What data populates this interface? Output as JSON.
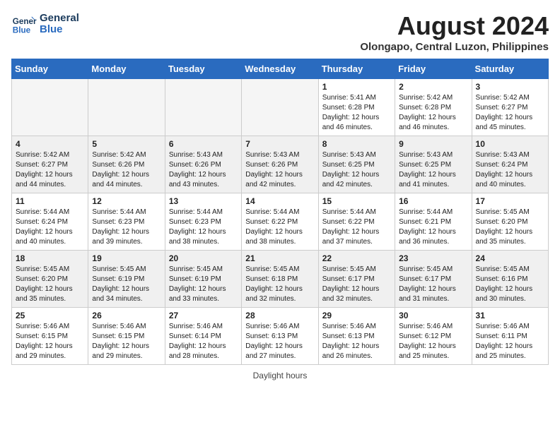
{
  "header": {
    "logo_line1": "General",
    "logo_line2": "Blue",
    "month": "August 2024",
    "location": "Olongapo, Central Luzon, Philippines"
  },
  "days_of_week": [
    "Sunday",
    "Monday",
    "Tuesday",
    "Wednesday",
    "Thursday",
    "Friday",
    "Saturday"
  ],
  "footer": {
    "daylight_hours_label": "Daylight hours"
  },
  "weeks": [
    [
      {
        "day": "",
        "info": ""
      },
      {
        "day": "",
        "info": ""
      },
      {
        "day": "",
        "info": ""
      },
      {
        "day": "",
        "info": ""
      },
      {
        "day": "1",
        "info": "Sunrise: 5:41 AM\nSunset: 6:28 PM\nDaylight: 12 hours\nand 46 minutes."
      },
      {
        "day": "2",
        "info": "Sunrise: 5:42 AM\nSunset: 6:28 PM\nDaylight: 12 hours\nand 46 minutes."
      },
      {
        "day": "3",
        "info": "Sunrise: 5:42 AM\nSunset: 6:27 PM\nDaylight: 12 hours\nand 45 minutes."
      }
    ],
    [
      {
        "day": "4",
        "info": "Sunrise: 5:42 AM\nSunset: 6:27 PM\nDaylight: 12 hours\nand 44 minutes."
      },
      {
        "day": "5",
        "info": "Sunrise: 5:42 AM\nSunset: 6:26 PM\nDaylight: 12 hours\nand 44 minutes."
      },
      {
        "day": "6",
        "info": "Sunrise: 5:43 AM\nSunset: 6:26 PM\nDaylight: 12 hours\nand 43 minutes."
      },
      {
        "day": "7",
        "info": "Sunrise: 5:43 AM\nSunset: 6:26 PM\nDaylight: 12 hours\nand 42 minutes."
      },
      {
        "day": "8",
        "info": "Sunrise: 5:43 AM\nSunset: 6:25 PM\nDaylight: 12 hours\nand 42 minutes."
      },
      {
        "day": "9",
        "info": "Sunrise: 5:43 AM\nSunset: 6:25 PM\nDaylight: 12 hours\nand 41 minutes."
      },
      {
        "day": "10",
        "info": "Sunrise: 5:43 AM\nSunset: 6:24 PM\nDaylight: 12 hours\nand 40 minutes."
      }
    ],
    [
      {
        "day": "11",
        "info": "Sunrise: 5:44 AM\nSunset: 6:24 PM\nDaylight: 12 hours\nand 40 minutes."
      },
      {
        "day": "12",
        "info": "Sunrise: 5:44 AM\nSunset: 6:23 PM\nDaylight: 12 hours\nand 39 minutes."
      },
      {
        "day": "13",
        "info": "Sunrise: 5:44 AM\nSunset: 6:23 PM\nDaylight: 12 hours\nand 38 minutes."
      },
      {
        "day": "14",
        "info": "Sunrise: 5:44 AM\nSunset: 6:22 PM\nDaylight: 12 hours\nand 38 minutes."
      },
      {
        "day": "15",
        "info": "Sunrise: 5:44 AM\nSunset: 6:22 PM\nDaylight: 12 hours\nand 37 minutes."
      },
      {
        "day": "16",
        "info": "Sunrise: 5:44 AM\nSunset: 6:21 PM\nDaylight: 12 hours\nand 36 minutes."
      },
      {
        "day": "17",
        "info": "Sunrise: 5:45 AM\nSunset: 6:20 PM\nDaylight: 12 hours\nand 35 minutes."
      }
    ],
    [
      {
        "day": "18",
        "info": "Sunrise: 5:45 AM\nSunset: 6:20 PM\nDaylight: 12 hours\nand 35 minutes."
      },
      {
        "day": "19",
        "info": "Sunrise: 5:45 AM\nSunset: 6:19 PM\nDaylight: 12 hours\nand 34 minutes."
      },
      {
        "day": "20",
        "info": "Sunrise: 5:45 AM\nSunset: 6:19 PM\nDaylight: 12 hours\nand 33 minutes."
      },
      {
        "day": "21",
        "info": "Sunrise: 5:45 AM\nSunset: 6:18 PM\nDaylight: 12 hours\nand 32 minutes."
      },
      {
        "day": "22",
        "info": "Sunrise: 5:45 AM\nSunset: 6:17 PM\nDaylight: 12 hours\nand 32 minutes."
      },
      {
        "day": "23",
        "info": "Sunrise: 5:45 AM\nSunset: 6:17 PM\nDaylight: 12 hours\nand 31 minutes."
      },
      {
        "day": "24",
        "info": "Sunrise: 5:45 AM\nSunset: 6:16 PM\nDaylight: 12 hours\nand 30 minutes."
      }
    ],
    [
      {
        "day": "25",
        "info": "Sunrise: 5:46 AM\nSunset: 6:15 PM\nDaylight: 12 hours\nand 29 minutes."
      },
      {
        "day": "26",
        "info": "Sunrise: 5:46 AM\nSunset: 6:15 PM\nDaylight: 12 hours\nand 29 minutes."
      },
      {
        "day": "27",
        "info": "Sunrise: 5:46 AM\nSunset: 6:14 PM\nDaylight: 12 hours\nand 28 minutes."
      },
      {
        "day": "28",
        "info": "Sunrise: 5:46 AM\nSunset: 6:13 PM\nDaylight: 12 hours\nand 27 minutes."
      },
      {
        "day": "29",
        "info": "Sunrise: 5:46 AM\nSunset: 6:13 PM\nDaylight: 12 hours\nand 26 minutes."
      },
      {
        "day": "30",
        "info": "Sunrise: 5:46 AM\nSunset: 6:12 PM\nDaylight: 12 hours\nand 25 minutes."
      },
      {
        "day": "31",
        "info": "Sunrise: 5:46 AM\nSunset: 6:11 PM\nDaylight: 12 hours\nand 25 minutes."
      }
    ]
  ]
}
